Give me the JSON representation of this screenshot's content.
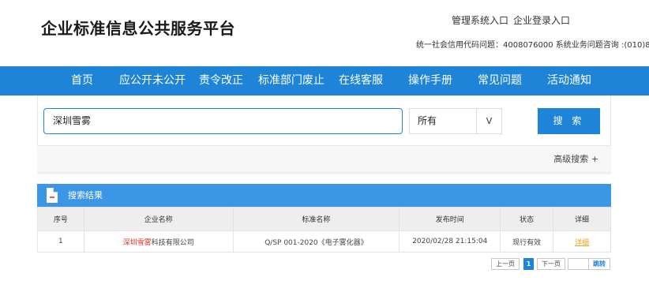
{
  "header": {
    "site_title": "企业标准信息公共服务平台",
    "admin_link": "管理系统入口",
    "login_link": "企业登录入口",
    "hotline": "统一社会信用代码问题：4008076000 系统业务问题咨询 :(010)8"
  },
  "nav": {
    "items": [
      "首页",
      "应公开未公开",
      "责令改正",
      "标准部门废止",
      "在线客服",
      "操作手册",
      "常见问题",
      "活动通知"
    ]
  },
  "search": {
    "query": "深圳雪雾",
    "scope_value": "所有",
    "scope_arrow": "V",
    "button_label": "搜 索",
    "advanced_label": "高级搜索 +"
  },
  "results": {
    "title": "搜索结果",
    "columns": [
      "序号",
      "企业名称",
      "标准名称",
      "发布时间",
      "状态",
      "详细"
    ],
    "rows": [
      {
        "index": "1",
        "company_highlight": "深圳雪雾",
        "company_rest": "科技有限公司",
        "standard": "Q/SP 001-2020《电子雾化器》",
        "published": "2020/02/28 21:15:04",
        "status": "现行有效",
        "detail": "详细"
      }
    ]
  },
  "pager": {
    "prev": "上一页",
    "current": "1",
    "next": "下一页",
    "jump_value": "",
    "go": "跳转"
  },
  "colors": {
    "primary_blue": "#1d84d8",
    "results_header_blue": "#3b96e6",
    "highlight_red": "#e0302a",
    "detail_link": "#e8a317"
  }
}
